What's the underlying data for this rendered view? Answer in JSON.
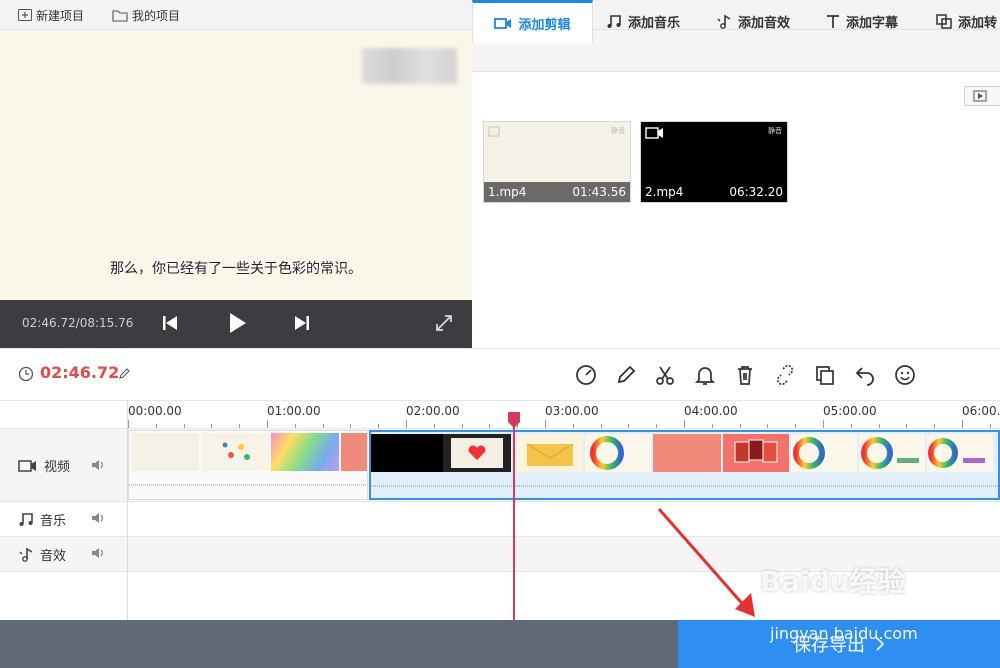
{
  "menu": {
    "new_project": "新建项目",
    "my_projects": "我的项目"
  },
  "preview": {
    "subtitle": "那么，你已经有了一些关于色彩的常识。",
    "timecode": "02:46.72/08:15.76"
  },
  "tabs": [
    {
      "label": "添加剪辑",
      "icon": "video-icon"
    },
    {
      "label": "添加音乐",
      "icon": "music-icon"
    },
    {
      "label": "添加音效",
      "icon": "sound-effect-icon"
    },
    {
      "label": "添加字幕",
      "icon": "text-icon"
    },
    {
      "label": "添加转",
      "icon": "transition-icon"
    }
  ],
  "media": [
    {
      "name": "1.mp4",
      "duration": "01:43.56",
      "label": "静音"
    },
    {
      "name": "2.mp4",
      "duration": "06:32.20",
      "label": "静音"
    }
  ],
  "timeline": {
    "current_time": "02:46.72",
    "ticks": [
      "00:00.00",
      "01:00.00",
      "02:00.00",
      "03:00.00",
      "04:00.00",
      "05:00.00",
      "06:00.00"
    ],
    "playhead_seconds": 166.72
  },
  "tracks": {
    "video": "视频",
    "music": "音乐",
    "effects": "音效"
  },
  "toolbar_icons": [
    "speed-icon",
    "edit-icon",
    "scissors-icon",
    "bell-icon",
    "delete-icon",
    "unlink-icon",
    "copy-icon",
    "undo-icon",
    "emoji-icon"
  ],
  "export": {
    "label": "保存导出"
  },
  "watermark": {
    "logo": "Baidu经验",
    "url": "jingyan.baidu.com"
  },
  "colors": {
    "accent": "#1e88e5",
    "time": "#e34b4b",
    "export": "#2e8ff0",
    "playhead": "#d23a5a"
  }
}
